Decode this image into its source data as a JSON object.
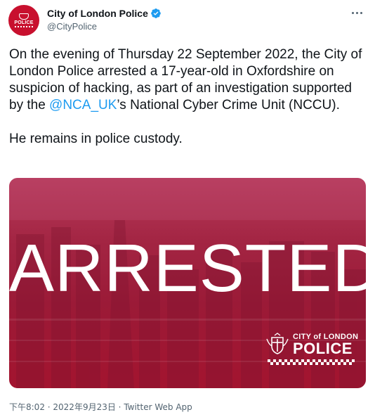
{
  "author": {
    "display_name": "City of London Police",
    "handle": "@CityPolice",
    "avatar_text": "POLICE",
    "verified_icon": "verified-badge-icon",
    "verified_color": "#1d9bf0"
  },
  "more_icon": "more-horizontal-icon",
  "tweet": {
    "text_before": "On the evening of Thursday 22 September 2022, the City of London Police arrested a 17-year-old in Oxfordshire on suspicion of hacking, as part of an investigation supported by the ",
    "mention": "@NCA_UK",
    "text_after": "’s National Cyber Crime Unit (NCCU).",
    "paragraph2": "He remains in police custody."
  },
  "media": {
    "headline": "ARRESTED",
    "logo_top": "CITY of LONDON",
    "logo_main": "POLICE",
    "background_color": "#a31c3a"
  },
  "meta": {
    "time": "下午8:02",
    "separator": " · ",
    "date": "2022年9月23日",
    "source": "Twitter Web App"
  },
  "colors": {
    "text": "#0f1419",
    "secondary": "#536471",
    "link": "#1d9bf0",
    "brand_red": "#c8102e"
  }
}
